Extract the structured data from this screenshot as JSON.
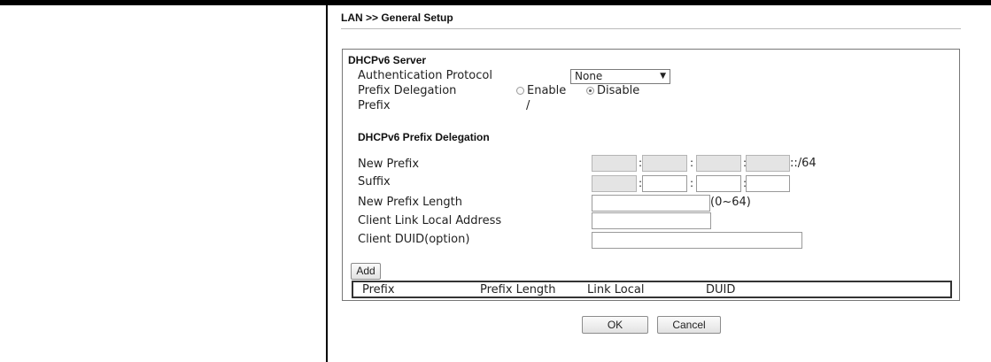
{
  "breadcrumb": "LAN >> General Setup",
  "server": {
    "title": "DHCPv6 Server",
    "auth_label": "Authentication Protocol",
    "auth_value": "None",
    "prefix_delegation_label": "Prefix Delegation",
    "enable_label": "Enable",
    "disable_label": "Disable",
    "prefix_label": "Prefix",
    "prefix_value": "/"
  },
  "delegation": {
    "title": "DHCPv6 Prefix Delegation",
    "new_prefix_label": "New Prefix",
    "new_prefix_suffix": "::/64",
    "suffix_label": "Suffix",
    "new_prefix_length_label": "New Prefix Length",
    "length_range": "(0~64)",
    "client_link_local_label": "Client Link Local Address",
    "client_duid_label": "Client DUID(option)"
  },
  "add_label": "Add",
  "table": {
    "columns": [
      "Prefix",
      "Prefix Length",
      "Link Local",
      "DUID"
    ]
  },
  "ok_label": "OK",
  "cancel_label": "Cancel"
}
